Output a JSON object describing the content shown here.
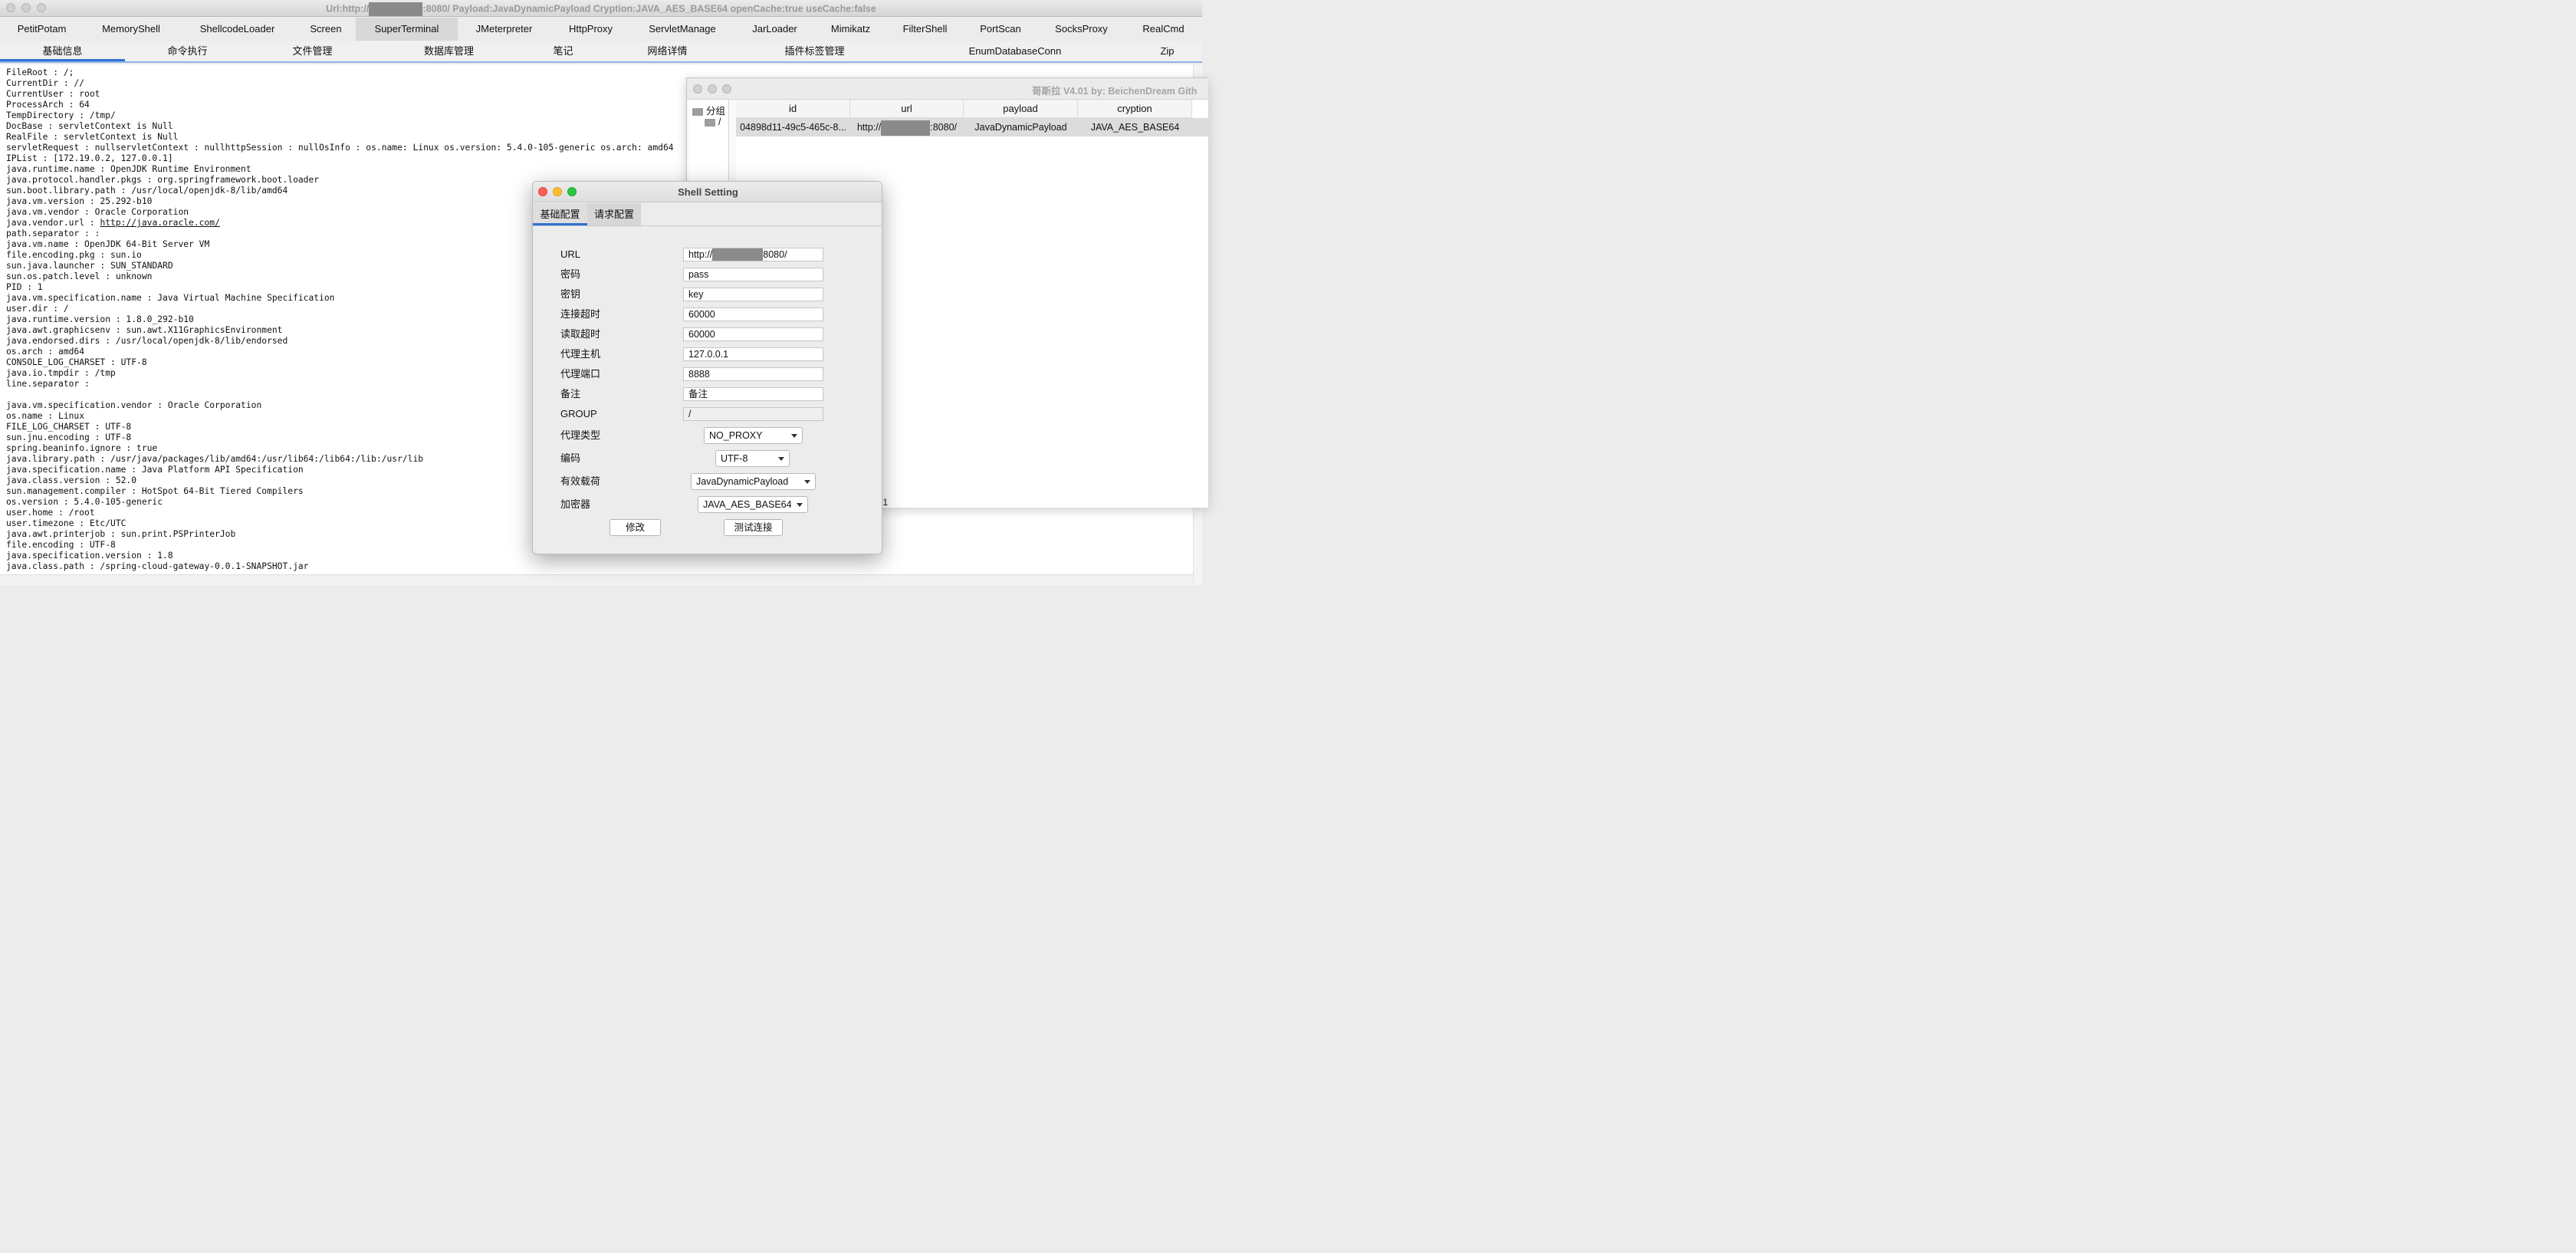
{
  "window": {
    "title_prefix": "Url:http://",
    "title_suffix": ":8080/ Payload:JavaDynamicPayload Cryption:JAVA_AES_BASE64 openCache:true useCache:false"
  },
  "plugin_tabs": [
    "PetitPotam",
    "MemoryShell",
    "ShellcodeLoader",
    "Screen",
    "SuperTerminal",
    "JMeterpreter",
    "HttpProxy",
    "ServletManage",
    "JarLoader",
    "Mimikatz",
    "FilterShell",
    "PortScan",
    "SocksProxy",
    "RealCmd"
  ],
  "sub_tabs": [
    "基础信息",
    "命令执行",
    "文件管理",
    "数据库管理",
    "笔记",
    "网络详情",
    "插件标签管理",
    "EnumDatabaseConn",
    "Zip"
  ],
  "info_lines": [
    "FileRoot : /;",
    "CurrentDir : //",
    "CurrentUser : root",
    "ProcessArch : 64",
    "TempDirectory : /tmp/",
    "DocBase : servletContext is Null",
    "RealFile : servletContext is Null",
    "servletRequest : nullservletContext : nullhttpSession : nullOsInfo : os.name: Linux os.version: 5.4.0-105-generic os.arch: amd64",
    "IPList : [172.19.0.2, 127.0.0.1]",
    "java.runtime.name : OpenJDK Runtime Environment",
    "java.protocol.handler.pkgs : org.springframework.boot.loader",
    "sun.boot.library.path : /usr/local/openjdk-8/lib/amd64",
    "java.vm.version : 25.292-b10",
    "java.vm.vendor : Oracle Corporation",
    "java.vendor.url : ",
    "path.separator : :",
    "java.vm.name : OpenJDK 64-Bit Server VM",
    "file.encoding.pkg : sun.io",
    "sun.java.launcher : SUN_STANDARD",
    "sun.os.patch.level : unknown",
    "PID : 1",
    "java.vm.specification.name : Java Virtual Machine Specification",
    "user.dir : /",
    "java.runtime.version : 1.8.0_292-b10",
    "java.awt.graphicsenv : sun.awt.X11GraphicsEnvironment",
    "java.endorsed.dirs : /usr/local/openjdk-8/lib/endorsed",
    "os.arch : amd64",
    "CONSOLE_LOG_CHARSET : UTF-8",
    "java.io.tmpdir : /tmp",
    "line.separator : ",
    "",
    "java.vm.specification.vendor : Oracle Corporation",
    "os.name : Linux",
    "FILE_LOG_CHARSET : UTF-8",
    "sun.jnu.encoding : UTF-8",
    "spring.beaninfo.ignore : true",
    "java.library.path : /usr/java/packages/lib/amd64:/usr/lib64:/lib64:/lib:/usr/lib",
    "java.specification.name : Java Platform API Specification",
    "java.class.version : 52.0",
    "sun.management.compiler : HotSpot 64-Bit Tiered Compilers",
    "os.version : 5.4.0-105-generic",
    "user.home : /root",
    "user.timezone : Etc/UTC",
    "java.awt.printerjob : sun.print.PSPrinterJob",
    "file.encoding : UTF-8",
    "java.specification.version : 1.8",
    "java.class.path : /spring-cloud-gateway-0.0.1-SNAPSHOT.jar"
  ],
  "vendor_url_link": "http://java.oracle.com/",
  "list_window": {
    "title": "哥斯拉   V4.01 by: BeichenDream Gith",
    "tree_root": "分组",
    "tree_child": "/",
    "columns": [
      "id",
      "url",
      "payload",
      "cryption"
    ],
    "row": {
      "id": "04898d11-49c5-465c-8...",
      "url_prefix": "http://",
      "url_suffix": ":8080/",
      "payload": "JavaDynamicPayload",
      "cryption": "JAVA_AES_BASE64"
    },
    "status": ":1"
  },
  "dialog": {
    "title": "Shell Setting",
    "tabs": [
      "基础配置",
      "请求配置"
    ],
    "fields": {
      "url_label": "URL",
      "url_prefix": "http://",
      "url_suffix": "8080/",
      "password_label": "密码",
      "password": "pass",
      "key_label": "密钥",
      "key": "key",
      "conn_timeout_label": "连接超时",
      "conn_timeout": "60000",
      "read_timeout_label": "读取超时",
      "read_timeout": "60000",
      "proxy_host_label": "代理主机",
      "proxy_host": "127.0.0.1",
      "proxy_port_label": "代理端口",
      "proxy_port": "8888",
      "remark_label": "备注",
      "remark": "备注",
      "group_label": "GROUP",
      "group": "/",
      "proxy_type_label": "代理类型",
      "proxy_type": "NO_PROXY",
      "encoding_label": "编码",
      "encoding": "UTF-8",
      "payload_label": "有效载荷",
      "payload": "JavaDynamicPayload",
      "cryption_label": "加密器",
      "cryption": "JAVA_AES_BASE64"
    },
    "buttons": {
      "modify": "修改",
      "test": "测试连接"
    }
  },
  "colors": {
    "accent": "#2f6fd1",
    "mac_close": "#ff5f57",
    "mac_min": "#febc2e",
    "mac_max": "#28c840",
    "redaction": "#8a8a8a"
  }
}
